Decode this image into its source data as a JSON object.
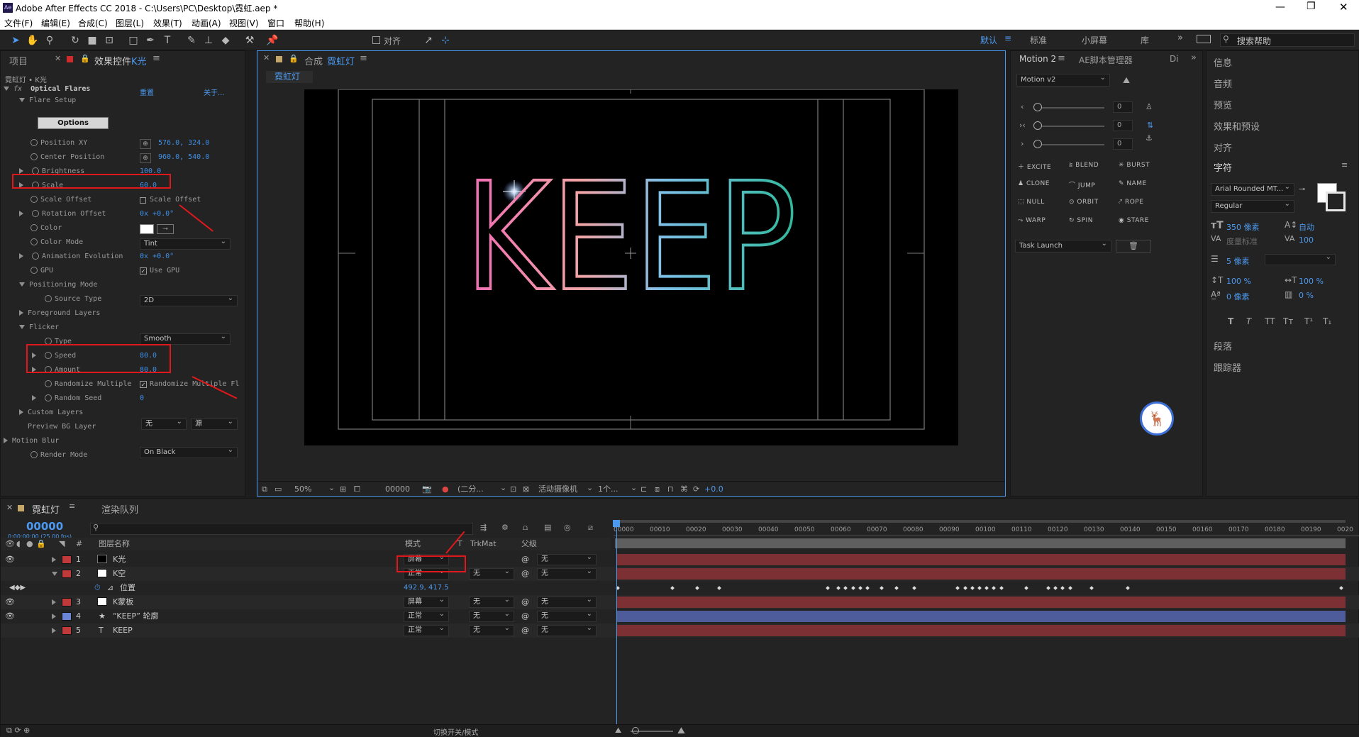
{
  "window": {
    "title": "Adobe After Effects CC 2018 - C:\\Users\\PC\\Desktop\\霓虹.aep *",
    "app_icon": "Ae"
  },
  "menu": [
    "文件(F)",
    "编辑(E)",
    "合成(C)",
    "图层(L)",
    "效果(T)",
    "动画(A)",
    "视图(V)",
    "窗口",
    "帮助(H)"
  ],
  "toolbar": {
    "align_label": "对齐",
    "workspaces": [
      "默认",
      "标准",
      "小屏幕",
      "库"
    ],
    "search_placeholder": "搜索帮助"
  },
  "left_panel": {
    "tabs": {
      "project": "项目",
      "effect_controls": "效果控件",
      "effect_layer": "K光"
    },
    "breadcrumb": "霓虹灯 • K光",
    "effect_name": "Optical Flares",
    "reset": "重置",
    "about": "关于...",
    "options_button": "Options",
    "props": [
      {
        "label": "Flare Setup"
      },
      {
        "label": "Position XY",
        "value": "576.0, 324.0"
      },
      {
        "label": "Center Position",
        "value": "960.0, 540.0"
      },
      {
        "label": "Brightness",
        "value": "100.0"
      },
      {
        "label": "Scale",
        "value": "60.0"
      },
      {
        "label": "Scale Offset",
        "value": "Scale Offset"
      },
      {
        "label": "Rotation Offset",
        "value": "0x +0.0°"
      },
      {
        "label": "Color"
      },
      {
        "label": "Color Mode",
        "value": "Tint"
      },
      {
        "label": "Animation Evolution",
        "value": "0x +0.0°"
      },
      {
        "label": "GPU",
        "value": "Use GPU"
      },
      {
        "label": "Positioning Mode"
      },
      {
        "label": "Source Type",
        "value": "2D"
      },
      {
        "label": "Foreground Layers"
      },
      {
        "label": "Flicker"
      },
      {
        "label": "Type",
        "value": "Smooth"
      },
      {
        "label": "Speed",
        "value": "80.0"
      },
      {
        "label": "Amount",
        "value": "80.0"
      },
      {
        "label": "Randomize Multiple",
        "value": "Randomize Multiple Fl"
      },
      {
        "label": "Random Seed",
        "value": "0"
      },
      {
        "label": "Custom Layers"
      },
      {
        "label": "Preview BG Layer",
        "value": "无",
        "value2": "源"
      },
      {
        "label": "Motion Blur"
      },
      {
        "label": "Render Mode",
        "value": "On Black"
      }
    ]
  },
  "comp_panel": {
    "tab_label": "合成",
    "comp_name": "霓虹灯",
    "comp_tag": "霓虹灯",
    "text": "KEEP",
    "footer": {
      "zoom": "50%",
      "timecode": "00000",
      "resolution": "(二分...",
      "camera": "活动摄像机",
      "views": "1个...",
      "exposure": "+0.0"
    }
  },
  "motion_panel": {
    "tabs": [
      "Motion 2",
      "AE脚本管理器",
      "Di"
    ],
    "preset": "Motion v2",
    "slider_values": [
      "0",
      "0",
      "0"
    ],
    "buttons": [
      "EXCITE",
      "BLEND",
      "BURST",
      "CLONE",
      "JUMP",
      "NAME",
      "NULL",
      "ORBIT",
      "ROPE",
      "WARP",
      "SPIN",
      "STARE"
    ],
    "task": "Task Launch"
  },
  "right_panel": {
    "items": [
      "信息",
      "音频",
      "预览",
      "效果和预设",
      "对齐"
    ],
    "character_title": "字符",
    "font": "Arial Rounded MT...",
    "style": "Regular",
    "size": "350 像素",
    "leading": "自动",
    "tracking_label": "度量标准",
    "tracking": "100",
    "stroke": "5 像素",
    "vscale": "100 %",
    "hscale": "100 %",
    "baseline": "0 像素",
    "tsume": "0 %",
    "format_buttons": [
      "T",
      "T",
      "TT",
      "Tт",
      "T¹",
      "T₁"
    ],
    "paragraph": "段落",
    "tracker": "跟踪器"
  },
  "timeline": {
    "tabs": {
      "comp": "霓虹灯",
      "render": "渲染队列"
    },
    "timecode": "00000",
    "timecode_sub": "0:00:00:00 (25.00 fps)",
    "search_placeholder": "",
    "headers": {
      "name": "图层名称",
      "mode": "模式",
      "t": "T",
      "trkmat": "TrkMat",
      "parent": "父级"
    },
    "ruler": [
      "00000",
      "00010",
      "00020",
      "00030",
      "00040",
      "00050",
      "00060",
      "00070",
      "00080",
      "00090",
      "00100",
      "00110",
      "00120",
      "00130",
      "00140",
      "00150",
      "00160",
      "00170",
      "00180",
      "00190",
      "0020"
    ],
    "layers": [
      {
        "num": "1",
        "name": "K光",
        "mode": "屏幕",
        "trkmat": "",
        "parent": "无",
        "color": "#c0393b"
      },
      {
        "num": "2",
        "name": "K空",
        "mode": "正常",
        "trkmat": "无",
        "parent": "无",
        "color": "#c0393b"
      },
      {
        "num": "",
        "name": "位置",
        "mode": "492.9, 417.5",
        "trkmat": "",
        "parent": "",
        "color": ""
      },
      {
        "num": "3",
        "name": "K蒙板",
        "mode": "屏幕",
        "trkmat": "无",
        "parent": "无",
        "color": "#c0393b"
      },
      {
        "num": "4",
        "name": "“KEEP” 轮廓",
        "mode": "正常",
        "trkmat": "无",
        "parent": "无",
        "color": "#6a84d6"
      },
      {
        "num": "5",
        "name": "KEEP",
        "mode": "正常",
        "trkmat": "无",
        "parent": "无",
        "color": "#c0393b"
      }
    ],
    "footer_toggle": "切换开关/模式"
  }
}
